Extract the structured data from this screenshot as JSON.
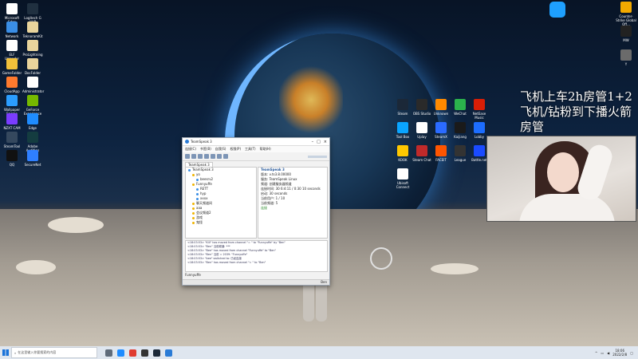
{
  "desktop_left_icons": [
    {
      "label": "Microsoft Edge",
      "color": "#ffffff"
    },
    {
      "label": "Logitech G HUB",
      "color": "#203040"
    },
    {
      "label": "Network",
      "color": "#3a8ee6"
    },
    {
      "label": "TeknoramKit",
      "color": "#e8d49c"
    },
    {
      "label": "ELF Uploader",
      "color": "#ffffff"
    },
    {
      "label": "ProLightning",
      "color": "#e8d49c"
    },
    {
      "label": "GameFolder",
      "color": "#f0c03a"
    },
    {
      "label": "DocFolder",
      "color": "#e8d49c"
    },
    {
      "label": "CloudApp",
      "color": "#ff7a2e"
    },
    {
      "label": "Administrator",
      "color": "#ffffff"
    },
    {
      "label": "Wallpaper Engine",
      "color": "#2b9dff"
    },
    {
      "label": "GeForce Experience",
      "color": "#76b900"
    },
    {
      "label": "NZXT CAM",
      "color": "#7a3cff"
    },
    {
      "label": "Edge",
      "color": "#1f8cff"
    },
    {
      "label": "SteamTool",
      "color": "#35485e"
    },
    {
      "label": "Adobe Audition",
      "color": "#143c40"
    },
    {
      "label": "QQ",
      "color": "#111111"
    },
    {
      "label": "SecureNet",
      "color": "#2f7fff"
    }
  ],
  "desktop_right_icons": [
    {
      "label": "Steam",
      "color": "#1b2838"
    },
    {
      "label": "OBS Studio",
      "color": "#2a2a2a"
    },
    {
      "label": "Unknown",
      "color": "#ff8a00"
    },
    {
      "label": "WeChat",
      "color": "#2bb24c"
    },
    {
      "label": "NetEase Music",
      "color": "#d81e06"
    },
    {
      "label": "Tool Box",
      "color": "#0aa5ff"
    },
    {
      "label": "Uplay",
      "color": "#ffffff"
    },
    {
      "label": "SteamX",
      "color": "#2b6bff"
    },
    {
      "label": "Kaijiang",
      "color": "#1a1a1a"
    },
    {
      "label": "Lobby",
      "color": "#1d6dff"
    },
    {
      "label": "KOOK",
      "color": "#ffc800"
    },
    {
      "label": "Steam Chat",
      "color": "#c02a2a"
    },
    {
      "label": "FACEIT",
      "color": "#ff5500"
    },
    {
      "label": "League",
      "color": "#333333"
    },
    {
      "label": "Battle.net",
      "color": "#1a4bff"
    },
    {
      "label": "Ubisoft Connect",
      "color": "#ffffff"
    }
  ],
  "desktop_far_right_icons": [
    {
      "label": "S",
      "color": "#1ea0ff"
    },
    {
      "label": "Counter-Strike Global Off...",
      "color": "#f2a900"
    },
    {
      "label": "MW",
      "color": "#222222"
    },
    {
      "label": "Y",
      "color": "#6b6b6b"
    }
  ],
  "overlay_text": "飞机上车2h房管1+2飞机/钻粉到下播火箭房管",
  "teamspeak": {
    "title": "TeamSpeak 3",
    "menu": [
      "连接(C)",
      "书签(B)",
      "自我(S)",
      "权限(P)",
      "工具(T)",
      "帮助(H)"
    ],
    "tab": "TeamSpeak 3",
    "tree": [
      {
        "text": "TeamSpeak 3",
        "indent": 0,
        "type": "server"
      },
      {
        "text": "yo",
        "indent": 1,
        "type": "channel"
      },
      {
        "text": "beesrv2",
        "indent": 2,
        "type": "user"
      },
      {
        "text": "Funnyuffe",
        "indent": 1,
        "type": "channel"
      },
      {
        "text": "RETT",
        "indent": 2,
        "type": "user"
      },
      {
        "text": "hyp",
        "indent": 2,
        "type": "user"
      },
      {
        "text": "xxxx",
        "indent": 2,
        "type": "user"
      },
      {
        "text": "聊天频道间",
        "indent": 1,
        "type": "channel"
      },
      {
        "text": "aaa",
        "indent": 1,
        "type": "channel"
      },
      {
        "text": "会议频道2",
        "indent": 1,
        "type": "channel"
      },
      {
        "text": "游戏",
        "indent": 1,
        "type": "channel"
      },
      {
        "text": "鬼怪",
        "indent": 1,
        "type": "channel"
      }
    ],
    "info_title": "TeamSpeak 3",
    "info_lines": [
      "版本: v.ts3.8.00000",
      "服务: TeamSpeak Linux",
      "频道: 创建服务器频道",
      "连接时间: 30 6:4:11 / 0:30 10 seconds",
      "启动: 30 seconds",
      "当前用户: 1 / 10",
      "当前频道: 5"
    ],
    "info_status": "连接",
    "chat": [
      "<18:03:53> \"Kill\" has moved from channel \"= \" to \"Funnyuffe\" by \"Ben\"",
      "<18:03:53> \"Ben\" 当前频道: ***",
      "<18:03:53> \"Bee\" has moved from channel \"Funnyuffe\" to \"Ben\"",
      "<18:03:53> \"Ben\" 当前 = 2039: \"Funnyuffe\"",
      "<18:03:53> \"bee\" switched to: 已经连接",
      "<18:03:53> \"Ben\" has moved from channel \"= \" to \"Ben\""
    ],
    "chat_tab": "Funnyuffe",
    "status_right": "Ben"
  },
  "taskbar": {
    "search_placeholder": "在这里输入你要搜索的内容",
    "apps": [
      {
        "name": "task-view",
        "color": "#5f6b7a"
      },
      {
        "name": "edge",
        "color": "#1f8cff"
      },
      {
        "name": "recorder",
        "color": "#e03c31"
      },
      {
        "name": "game",
        "color": "#333333"
      },
      {
        "name": "steam",
        "color": "#1b2838"
      },
      {
        "name": "teamspeak",
        "color": "#2a7bd6"
      }
    ],
    "time": "18:06",
    "date": "2022/2/8"
  }
}
